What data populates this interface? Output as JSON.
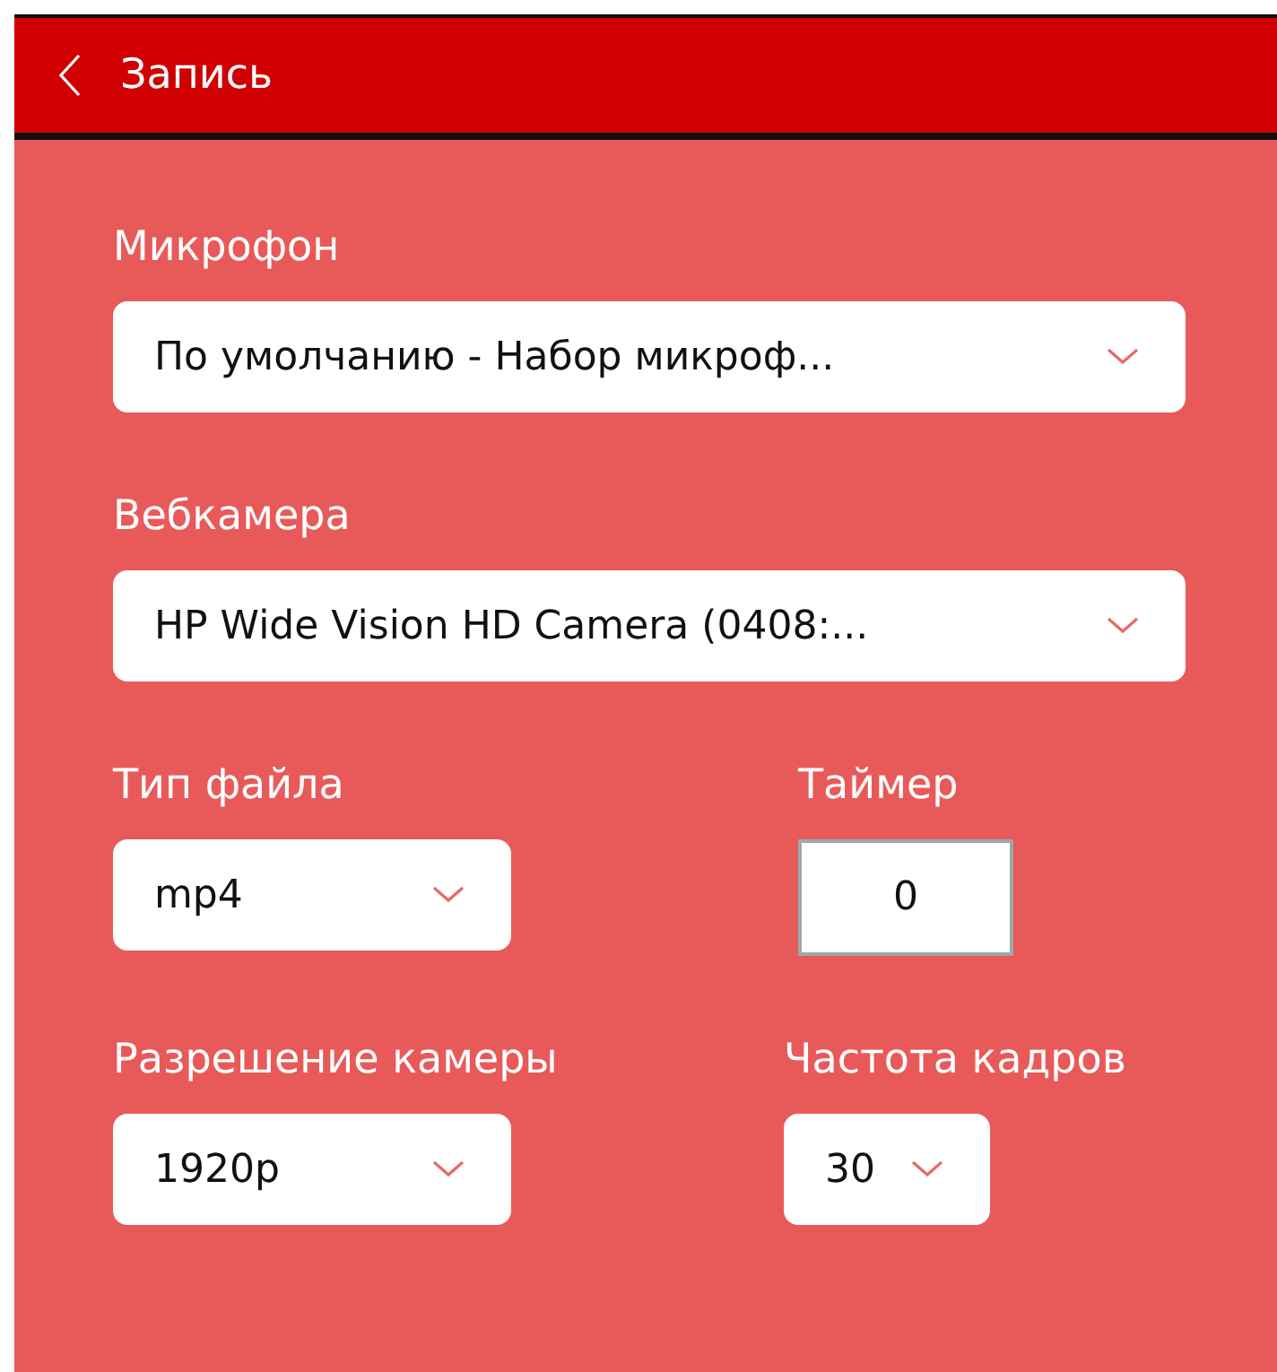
{
  "header": {
    "title": "Запись"
  },
  "rows": [
    [
      {
        "kind": "dropdown",
        "label": "Микрофон",
        "value": "По умолчанию - Набор микроф..."
      }
    ],
    [
      {
        "kind": "dropdown",
        "label": "Вебкамера",
        "value": "HP Wide Vision HD Camera (0408:..."
      }
    ],
    [
      {
        "kind": "dropdown",
        "label": "Тип файла",
        "value": "mp4"
      },
      {
        "kind": "number",
        "label": "Таймер",
        "value": "0"
      }
    ],
    [
      {
        "kind": "dropdown",
        "label": "Разрешение камеры",
        "value": "1920p"
      },
      {
        "kind": "dropdown",
        "label": "Частота кадров",
        "value": "30"
      }
    ]
  ]
}
